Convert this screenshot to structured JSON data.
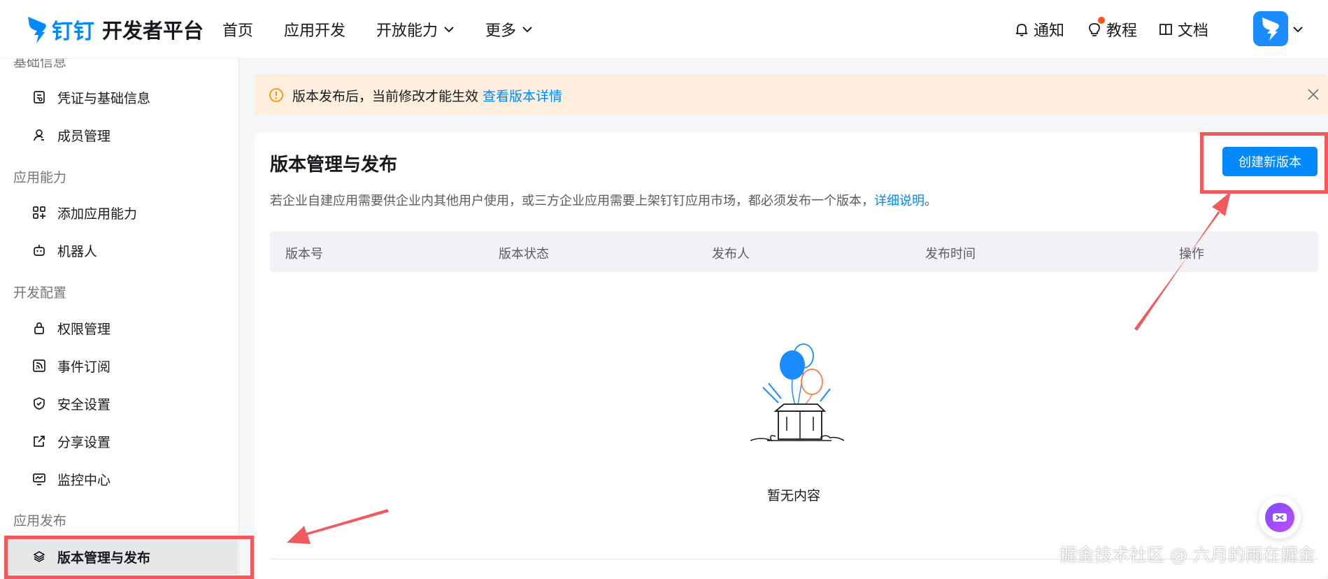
{
  "header": {
    "brand": "钉钉",
    "title": "开发者平台",
    "nav": [
      {
        "label": "首页"
      },
      {
        "label": "应用开发"
      },
      {
        "label": "开放能力"
      },
      {
        "label": "更多"
      }
    ],
    "right": {
      "notify": "通知",
      "tutorial": "教程",
      "docs": "文档"
    }
  },
  "sidebar": {
    "groups": [
      {
        "label": "基础信息"
      },
      {
        "label": "应用能力"
      },
      {
        "label": "开发配置"
      },
      {
        "label": "应用发布"
      }
    ],
    "items": [
      {
        "label": "凭证与基础信息",
        "icon": "credential-icon"
      },
      {
        "label": "成员管理",
        "icon": "user-icon"
      },
      {
        "label": "添加应用能力",
        "icon": "grid-plus-icon"
      },
      {
        "label": "机器人",
        "icon": "robot-icon"
      },
      {
        "label": "权限管理",
        "icon": "lock-icon"
      },
      {
        "label": "事件订阅",
        "icon": "rss-icon"
      },
      {
        "label": "安全设置",
        "icon": "shield-icon"
      },
      {
        "label": "分享设置",
        "icon": "share-icon"
      },
      {
        "label": "监控中心",
        "icon": "monitor-icon"
      },
      {
        "label": "版本管理与发布",
        "icon": "layers-icon",
        "active": true
      }
    ]
  },
  "alert": {
    "text": "版本发布后，当前修改才能生效",
    "link": "查看版本详情"
  },
  "main": {
    "title": "版本管理与发布",
    "desc": "若企业自建应用需要供企业内其他用户使用，或三方企业应用需要上架钉钉应用市场，都必须发布一个版本，",
    "desc_link": "详细说明",
    "desc_end": "。",
    "create_button": "创建新版本",
    "columns": [
      "版本号",
      "版本状态",
      "发布人",
      "发布时间",
      "操作"
    ],
    "empty_text": "暂无内容"
  },
  "watermark": "掘金技术社区 @ 六月的雨在掘金",
  "colors": {
    "accent": "#0089ff",
    "alert_bg": "#fdeede",
    "annotation": "#f2595c"
  }
}
